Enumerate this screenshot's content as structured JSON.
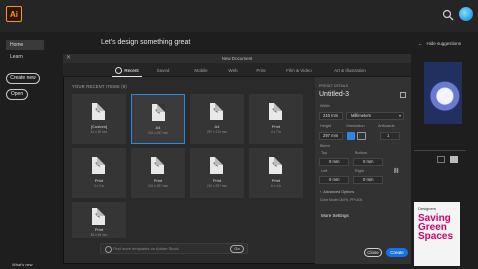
{
  "app": {
    "logo_text": "Ai",
    "greeting": "Let's design something great",
    "hide_suggestions": "Hide suggestions"
  },
  "nav": {
    "items": [
      {
        "label": "Home"
      },
      {
        "label": "Learn"
      }
    ],
    "create_new": "Create new",
    "open": "Open",
    "whats_new": "What's new"
  },
  "dialog": {
    "title": "New Document",
    "tabs": [
      {
        "label": "Recent"
      },
      {
        "label": "Saved"
      },
      {
        "label": "Mobile"
      },
      {
        "label": "Web"
      },
      {
        "label": "Print"
      },
      {
        "label": "Film & Video"
      },
      {
        "label": "Art & Illustration"
      }
    ],
    "recent_heading": "YOUR RECENT ITEMS (8)",
    "tiles": [
      {
        "name": "[Custom]",
        "size": "81 x 30 mm"
      },
      {
        "name": "A4",
        "size": "210 x 297 mm"
      },
      {
        "name": "A4",
        "size": "297 x 210 mm"
      },
      {
        "name": "Print",
        "size": "4 x 7 in"
      },
      {
        "name": "Print",
        "size": "3 x 3 in"
      },
      {
        "name": "Print",
        "size": "210 x 297 mm"
      },
      {
        "name": "Print",
        "size": "210 x 297 mm"
      },
      {
        "name": "Print",
        "size": "6 x 4 in"
      },
      {
        "name": "Print",
        "size": "85 x 55 mm"
      }
    ],
    "template_search_placeholder": "Find more templates on Adobe Stock",
    "go": "Go",
    "preset": {
      "section": "PRESET DETAILS",
      "name": "Untitled-3",
      "width_label": "Width",
      "width": "210 mm",
      "units": "Millimeters",
      "height_label": "Height",
      "height": "297 mm",
      "orientation_label": "Orientation",
      "artboards_label": "Artboards",
      "artboards": "1",
      "bleed_label": "Bleed",
      "top_label": "Top",
      "top": "0 mm",
      "bottom_label": "Bottom",
      "bottom": "0 mm",
      "left_label": "Left",
      "left": "0 mm",
      "right_label": "Right",
      "right": "0 mm",
      "advanced": "Advanced Options",
      "color_mode": "Color Mode:CMYK, PPI:300",
      "more_settings": "More Settings",
      "close": "Close",
      "create": "Create"
    }
  },
  "background": {
    "book_line1": "Designers",
    "book_line2": "Saving Green Spaces"
  }
}
